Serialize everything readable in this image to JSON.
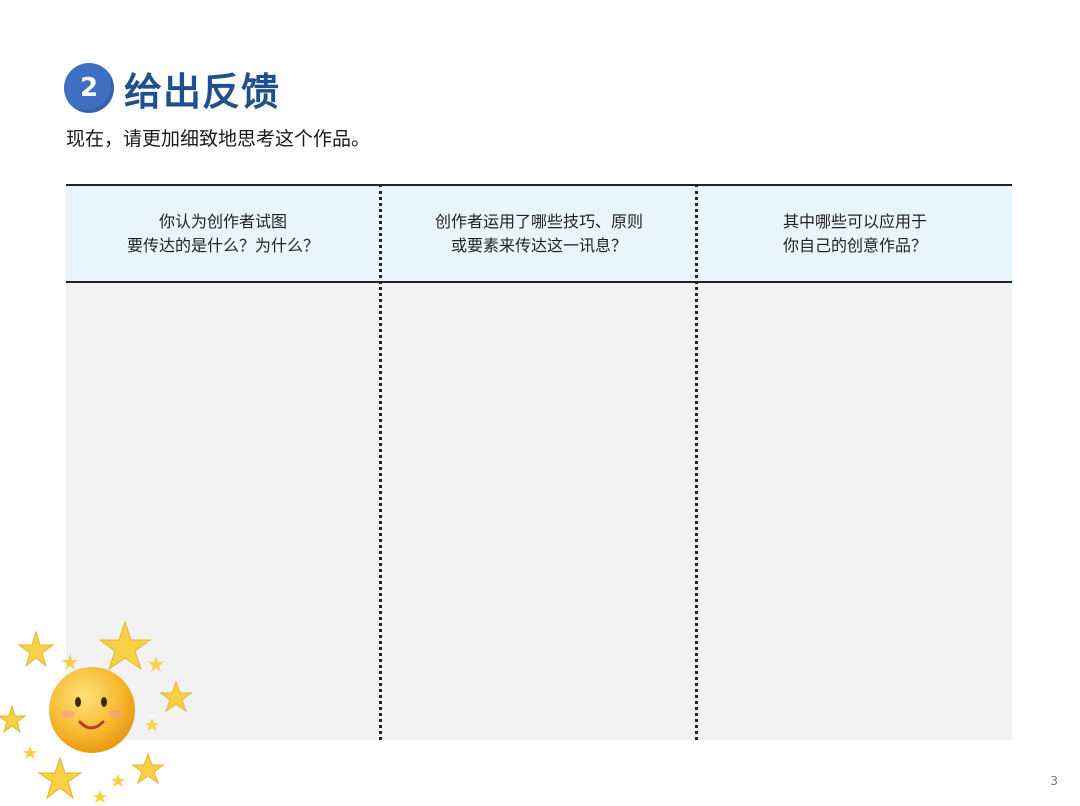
{
  "section": {
    "number": "2",
    "title": "给出反馈",
    "subtitle": "现在，请更加细致地思考这个作品。"
  },
  "table": {
    "columns": [
      {
        "line1": "你认为创作者试图",
        "line2": "要传达的是什么？为什么？"
      },
      {
        "line1": "创作者运用了哪些技巧、原则",
        "line2": "或要素来传达这一讯息？"
      },
      {
        "line1": "其中哪些可以应用于",
        "line2": "你自己的创意作品？"
      }
    ]
  },
  "page_number": "3",
  "colors": {
    "badge": "#3f6fc1",
    "title": "#1f4f8c",
    "header_bg": "#e8f5fd",
    "body_bg": "#f2f2f2"
  },
  "decoration": {
    "icon": "smiling-sun-with-stars"
  }
}
